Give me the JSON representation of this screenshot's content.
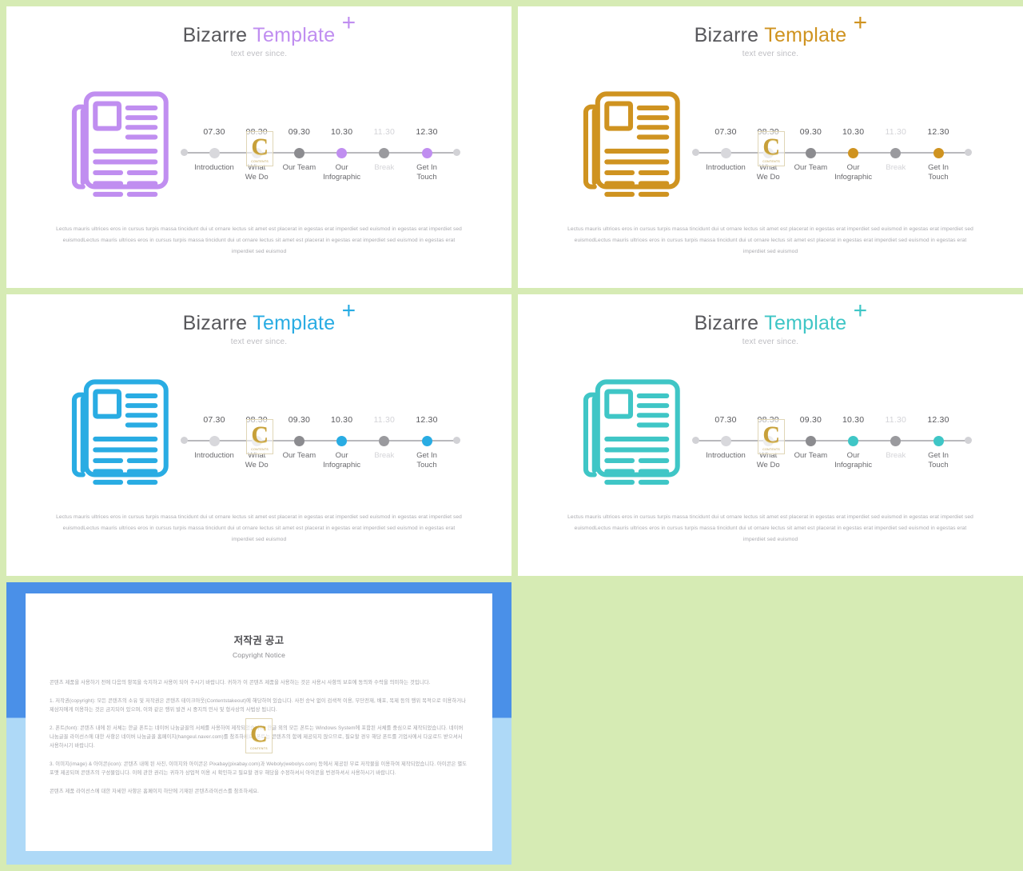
{
  "background_color": "#d6ebb4",
  "watermark": {
    "letter": "C",
    "caption": "CONTENTS"
  },
  "slides": [
    {
      "id": "slide-1",
      "accent": "#c08ef0",
      "icon_name": "newspaper-icon",
      "title_word1": "Bizarre",
      "title_word2": "Template",
      "plus": "+",
      "subtitle": "text ever since.",
      "timeline": [
        {
          "time": "07.30",
          "label": "Introduction",
          "state": "pale"
        },
        {
          "time": "08.30",
          "label": "What\nWe Do",
          "state": "pale"
        },
        {
          "time": "09.30",
          "label": "Our Team",
          "state": "normal"
        },
        {
          "time": "10.30",
          "label": "Our\nInfographic",
          "state": "accent"
        },
        {
          "time": "11.30",
          "label": "Break",
          "state": "muted"
        },
        {
          "time": "12.30",
          "label": "Get In\nTouch",
          "state": "accent"
        }
      ],
      "body": "Lectus mauris ultrices eros in cursus turpis massa tincidunt dui ut ornare lectus sit amet est placerat in egestas erat imperdiet sed euismod in egestas erat imperdiet sed euismodLectus mauris ultrices eros in cursus turpis massa tincidunt dui ut ornare lectus sit amet est placerat in egestas erat imperdiet sed euismod in egestas erat imperdiet sed euismod"
    },
    {
      "id": "slide-2",
      "accent": "#cf9320",
      "icon_name": "newspaper-icon",
      "title_word1": "Bizarre",
      "title_word2": "Template",
      "plus": "+",
      "subtitle": "text ever since.",
      "timeline": [
        {
          "time": "07.30",
          "label": "Introduction",
          "state": "pale"
        },
        {
          "time": "08.30",
          "label": "What\nWe Do",
          "state": "pale"
        },
        {
          "time": "09.30",
          "label": "Our Team",
          "state": "normal"
        },
        {
          "time": "10.30",
          "label": "Our\nInfographic",
          "state": "accent"
        },
        {
          "time": "11.30",
          "label": "Break",
          "state": "muted"
        },
        {
          "time": "12.30",
          "label": "Get In\nTouch",
          "state": "accent"
        }
      ],
      "body": "Lectus mauris ultrices eros in cursus turpis massa tincidunt dui ut ornare lectus sit amet est placerat in egestas erat imperdiet sed euismod in egestas erat imperdiet sed euismodLectus mauris ultrices eros in cursus turpis massa tincidunt dui ut ornare lectus sit amet est placerat in egestas erat imperdiet sed euismod in egestas erat imperdiet sed euismod"
    },
    {
      "id": "slide-3",
      "accent": "#29ace3",
      "icon_name": "newspaper-icon",
      "title_word1": "Bizarre",
      "title_word2": "Template",
      "plus": "+",
      "subtitle": "text ever since.",
      "timeline": [
        {
          "time": "07.30",
          "label": "Introduction",
          "state": "pale"
        },
        {
          "time": "08.30",
          "label": "What\nWe Do",
          "state": "pale"
        },
        {
          "time": "09.30",
          "label": "Our Team",
          "state": "normal"
        },
        {
          "time": "10.30",
          "label": "Our\nInfographic",
          "state": "accent"
        },
        {
          "time": "11.30",
          "label": "Break",
          "state": "muted"
        },
        {
          "time": "12.30",
          "label": "Get In\nTouch",
          "state": "accent"
        }
      ],
      "body": "Lectus mauris ultrices eros in cursus turpis massa tincidunt dui ut ornare lectus sit amet est placerat in egestas erat imperdiet sed euismod in egestas erat imperdiet sed euismodLectus mauris ultrices eros in cursus turpis massa tincidunt dui ut ornare lectus sit amet est placerat in egestas erat imperdiet sed euismod in egestas erat imperdiet sed euismod"
    },
    {
      "id": "slide-4",
      "accent": "#3fc6c6",
      "icon_name": "newspaper-icon",
      "title_word1": "Bizarre",
      "title_word2": "Template",
      "plus": "+",
      "subtitle": "text ever since.",
      "timeline": [
        {
          "time": "07.30",
          "label": "Introduction",
          "state": "pale"
        },
        {
          "time": "08.30",
          "label": "What\nWe Do",
          "state": "pale"
        },
        {
          "time": "09.30",
          "label": "Our Team",
          "state": "normal"
        },
        {
          "time": "10.30",
          "label": "Our\nInfographic",
          "state": "accent"
        },
        {
          "time": "11.30",
          "label": "Break",
          "state": "muted"
        },
        {
          "time": "12.30",
          "label": "Get In\nTouch",
          "state": "accent"
        }
      ],
      "body": "Lectus mauris ultrices eros in cursus turpis massa tincidunt dui ut ornare lectus sit amet est placerat in egestas erat imperdiet sed euismod in egestas erat imperdiet sed euismodLectus mauris ultrices eros in cursus turpis massa tincidunt dui ut ornare lectus sit amet est placerat in egestas erat imperdiet sed euismod in egestas erat imperdiet sed euismod"
    }
  ],
  "copyright": {
    "frame_color_top": "#4a90e8",
    "frame_color_bottom": "#aed9f7",
    "title": "저작권 공고",
    "subtitle": "Copyright Notice",
    "paragraphs": [
      "콘텐츠 제품을 사용하기 전에 다음의 항목을 숙지하고 사용이 되어 주시기 바랍니다. 귀하가 이 콘텐츠 제품을 사용하는 것은 사용시 사항의 보호에 동의와 수락을 의미하는 것입니다.",
      "1. 저작권(copyright): 모든 콘텐츠의 소유 및 저작권은 콘텐츠 테이크아웃(Contentstakeout)에 해당하여 있습니다. 사전 승낙 없이 검색적 이용, 무단전재, 배포, 복제 등의 행위 목적으로 이용하거나 제삼자에게 이용하는 것은 금지되어 있으며, 이와 같은 행위 발견 시 중지의 민사 및 형사상의 사법상 됩니다.",
      "2. 폰트(font): 콘텐츠 내에 된 서체는 한글 폰트는 네이버 나눔글꼴의 서체를 사용하여 제작되었습니다. 한글 외의 모든 폰트는 Windows System에 포함된 서체를 중심으로 제작되었습니다. 네이버 나눔글꼴 라이선스에 대한 사항은 네이버 나눔글꼴 홈페이지(hangeul.naver.com)를 참조하세요. 폰트는 콘텐츠의 함께 제공되지 않으므로, 필요할 경우 해당 폰트를 기업사에서 다운로드 받으셔서 사용하시기 바랍니다.",
      "3. 이미지(image) & 아이콘(icon): 콘텐츠 내에 된 사진, 이미지와 아이콘은 Pixabay(pixabay.com)과 Weboly(webolys.com) 등에서 제공된 무료 저작물을 이용하여 제작되었습니다. 아이콘은 별도 포맷 제공되며 콘텐츠의 구성물입니다. 이에 관한 권리는 귀하가 상업적 이용 시 확인하고 필요할 경우 해당을 수정하셔서 아이콘을 번경하셔서 사용하시기 바랍니다.",
      "콘텐츠 제품 라이선스에 대한 자세한 사항은 홈페이지 하단에 기재된 콘텐츠라이선스를 참조하세요."
    ]
  }
}
